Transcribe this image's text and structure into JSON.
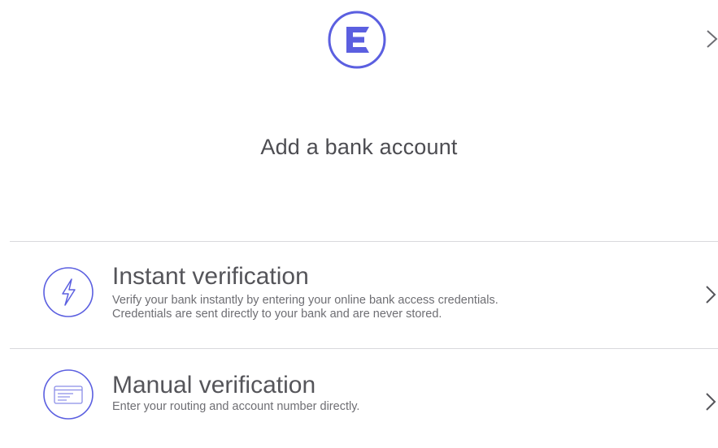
{
  "header": {
    "logo_icon": "e-brand-logo",
    "close_icon": "chevron-right-icon"
  },
  "title": "Add a bank account",
  "options": [
    {
      "title": "Instant verification",
      "description_line1": "Verify your bank instantly by entering your online bank access credentials.",
      "description_line2": "Credentials are sent directly to your bank and are never stored.",
      "icon": "lightning-bolt-icon"
    },
    {
      "title": "Manual verification",
      "description_line1": "Enter your routing and account number directly.",
      "icon": "document-form-icon"
    }
  ],
  "colors": {
    "accent": "#5b5fe0",
    "text": "#4d4d52",
    "divider": "#d9d9dc"
  }
}
